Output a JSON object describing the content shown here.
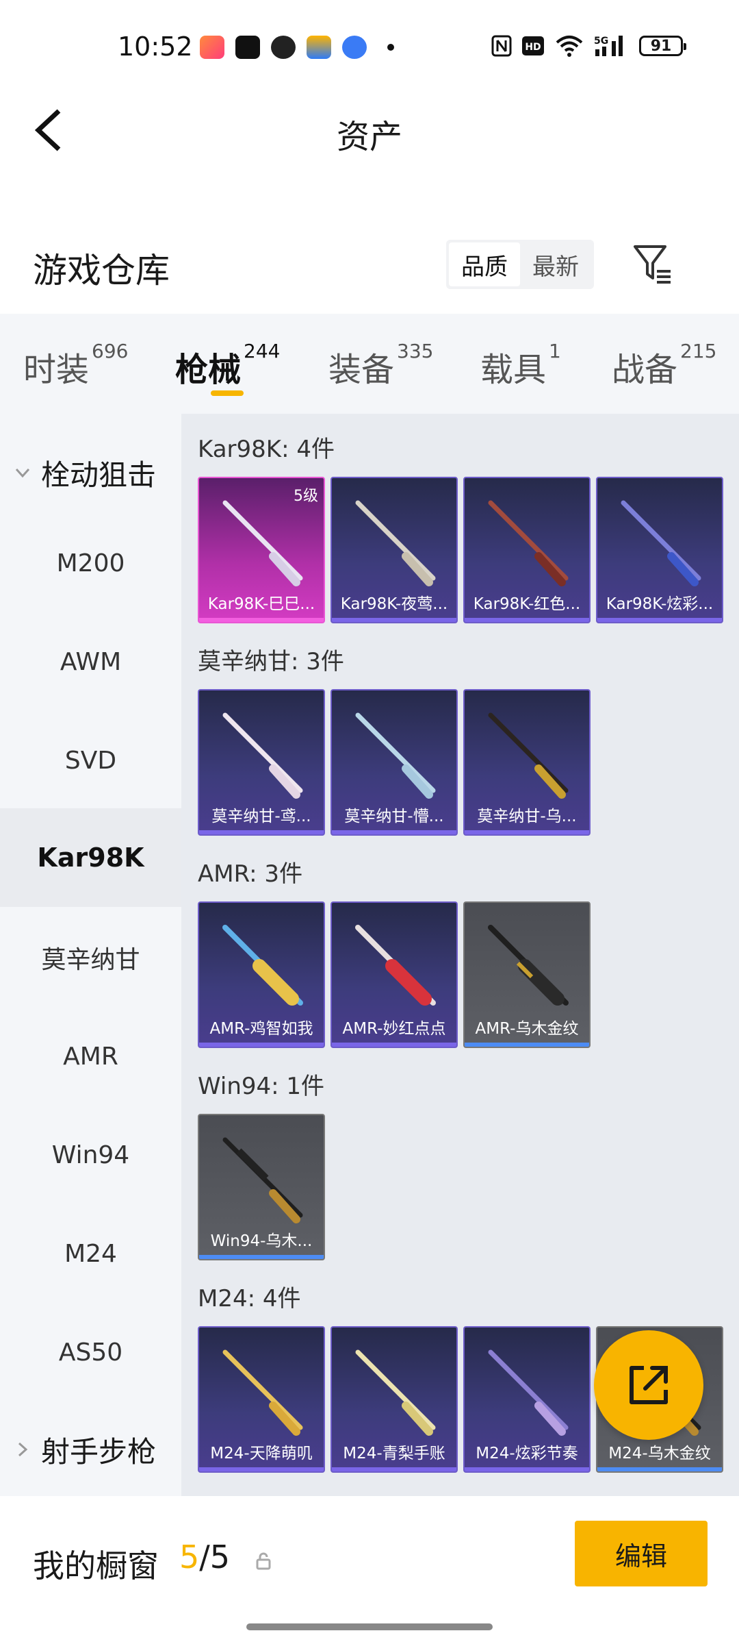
{
  "status_bar": {
    "time": "10:52",
    "battery": "91",
    "icons": [
      "nfc-icon",
      "hd-icon",
      "wifi-icon",
      "5g-signal-icon"
    ]
  },
  "header": {
    "title": "资产"
  },
  "warehouse": {
    "title": "游戏仓库",
    "sort_options": [
      "品质",
      "最新"
    ],
    "active_sort": "品质"
  },
  "tabs": [
    {
      "label": "时装",
      "count": "696"
    },
    {
      "label": "枪械",
      "count": "244"
    },
    {
      "label": "装备",
      "count": "335"
    },
    {
      "label": "载具",
      "count": "1"
    },
    {
      "label": "战备",
      "count": "215"
    }
  ],
  "active_tab": "枪械",
  "sidebar": {
    "group_expanded": "栓动狙击",
    "items": [
      "M200",
      "AWM",
      "SVD",
      "Kar98K",
      "莫辛纳甘",
      "AMR",
      "Win94",
      "M24",
      "AS50"
    ],
    "active": "Kar98K",
    "group_collapsed": "射手步枪"
  },
  "sections": [
    {
      "title": "Kar98K: 4件",
      "items": [
        {
          "name": "Kar98K-巳巳...",
          "level": "5级",
          "rarity": "pink"
        },
        {
          "name": "Kar98K-夜莺...",
          "rarity": "purple"
        },
        {
          "name": "Kar98K-红色...",
          "rarity": "purple"
        },
        {
          "name": "Kar98K-炫彩...",
          "rarity": "purple"
        }
      ]
    },
    {
      "title": "莫辛纳甘: 3件",
      "items": [
        {
          "name": "莫辛纳甘-鸢...",
          "rarity": "purple"
        },
        {
          "name": "莫辛纳甘-懵...",
          "rarity": "purple"
        },
        {
          "name": "莫辛纳甘-乌...",
          "rarity": "purple"
        }
      ]
    },
    {
      "title": "AMR: 3件",
      "items": [
        {
          "name": "AMR-鸡智如我",
          "rarity": "purple"
        },
        {
          "name": "AMR-妙红点点",
          "rarity": "purple"
        },
        {
          "name": "AMR-乌木金纹",
          "rarity": "gray"
        }
      ]
    },
    {
      "title": "Win94: 1件",
      "items": [
        {
          "name": "Win94-乌木...",
          "rarity": "gray"
        }
      ]
    },
    {
      "title": "M24: 4件",
      "items": [
        {
          "name": "M24-天降萌叽",
          "rarity": "purple"
        },
        {
          "name": "M24-青梨手账",
          "rarity": "purple"
        },
        {
          "name": "M24-炫彩节奏",
          "rarity": "purple"
        },
        {
          "name": "M24-乌木金纹",
          "rarity": "gray"
        }
      ]
    }
  ],
  "showcase": {
    "label": "我的橱窗",
    "current": "5",
    "total": "/5",
    "edit_label": "编辑"
  },
  "colors": {
    "accent": "#f7b500",
    "purple_rarity": "#6d5cc9",
    "pink_rarity": "#e956d4"
  }
}
